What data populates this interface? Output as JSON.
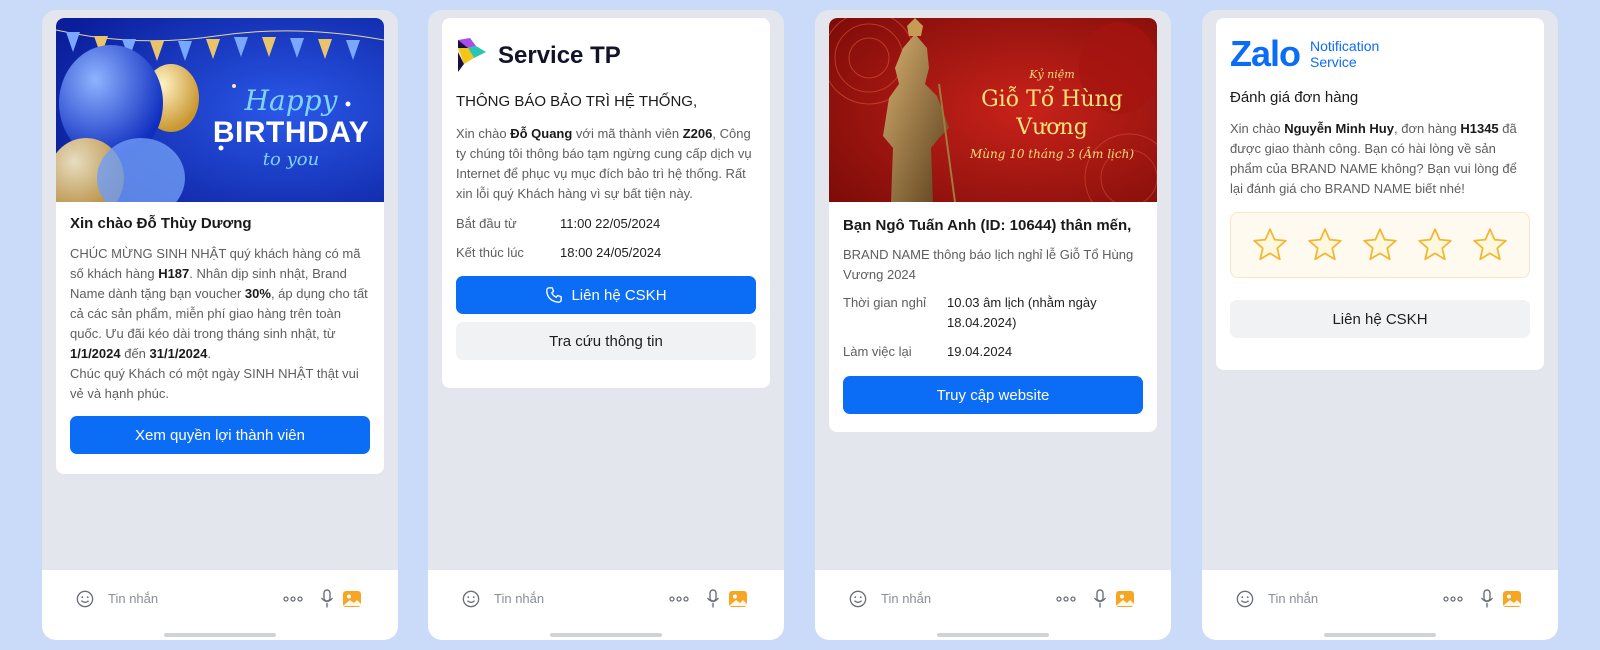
{
  "colors": {
    "background": "#c9dbf8",
    "primary_button": "#0b6cf6",
    "zalo_brand": "#0b6cf6"
  },
  "chatbar": {
    "placeholder": "Tin nhắn"
  },
  "card1": {
    "banner": {
      "line1": "Happy",
      "line2": "BIRTHDAY",
      "line3": "to you"
    },
    "greeting": "Xin chào Đỗ Thùy Dương",
    "body": {
      "t1": "CHÚC MỪNG SINH NHẬT quý khách hàng có mã số khách hàng ",
      "code": "H187",
      "t2": ". Nhân dịp sinh nhật, Brand Name dành tặng bạn voucher ",
      "voucher": "30%",
      "t3": ", áp dụng cho tất cả các sản phẩm, miễn phí giao hàng trên toàn quốc. Ưu đãi kéo dài trong tháng sinh nhật, từ ",
      "start": "1/1/2024",
      "t4": " đến ",
      "end": "31/1/2024",
      "t5": ".",
      "wish": "Chúc quý Khách có một ngày SINH NHẬT thật vui vẻ và hạnh phúc."
    },
    "button": "Xem quyền lợi thành viên"
  },
  "card2": {
    "brand": "Service TP",
    "title": "THÔNG BÁO BẢO TRÌ HỆ THỐNG,",
    "body": {
      "t1": "Xin chào ",
      "name": "Đỗ Quang",
      "t2": " với mã thành viên ",
      "code": "Z206",
      "t3": ", Công ty chúng tôi thông báo tạm ngừng cung cấp dịch vụ Internet để phục vụ mục đích bảo trì hệ thống. Rất xin lỗi quý Khách hàng vì sự bất tiện này."
    },
    "rows": [
      {
        "label": "Bắt đầu từ",
        "value": "11:00 22/05/2024"
      },
      {
        "label": "Kết thúc lúc",
        "value": "18:00 24/05/2024"
      }
    ],
    "button_primary": "Liên hệ CSKH",
    "button_secondary": "Tra cứu thông tin"
  },
  "card3": {
    "banner": {
      "small": "Kỷ niệm",
      "title": "Giỗ Tổ Hùng Vương",
      "sub": "Mùng 10 tháng 3 (Âm lịch)"
    },
    "greeting": "Bạn Ngô Tuấn Anh (ID: 10644) thân mến,",
    "body": "BRAND NAME thông báo lịch nghỉ lễ Giỗ Tổ Hùng Vương 2024",
    "rows": [
      {
        "label": "Thời gian nghỉ",
        "value": "10.03 âm lịch (nhằm ngày 18.04.2024)"
      },
      {
        "label": "Làm việc lại",
        "value": "19.04.2024"
      }
    ],
    "button": "Truy cập website"
  },
  "card4": {
    "brand": "Zalo",
    "brand_sub1": "Notification",
    "brand_sub2": "Service",
    "title": "Đánh giá đơn hàng",
    "body": {
      "t1": "Xin chào ",
      "name": "Nguyễn Minh Huy",
      "t2": ", đơn hàng ",
      "order": "H1345",
      "t3": " đã được giao thành công. Bạn có hài lòng về sản phẩm của BRAND NAME không? Bạn vui lòng để lại đánh giá cho BRAND NAME biết nhé!"
    },
    "rating": {
      "max": 5,
      "value": 0
    },
    "button": "Liên hệ CSKH"
  }
}
